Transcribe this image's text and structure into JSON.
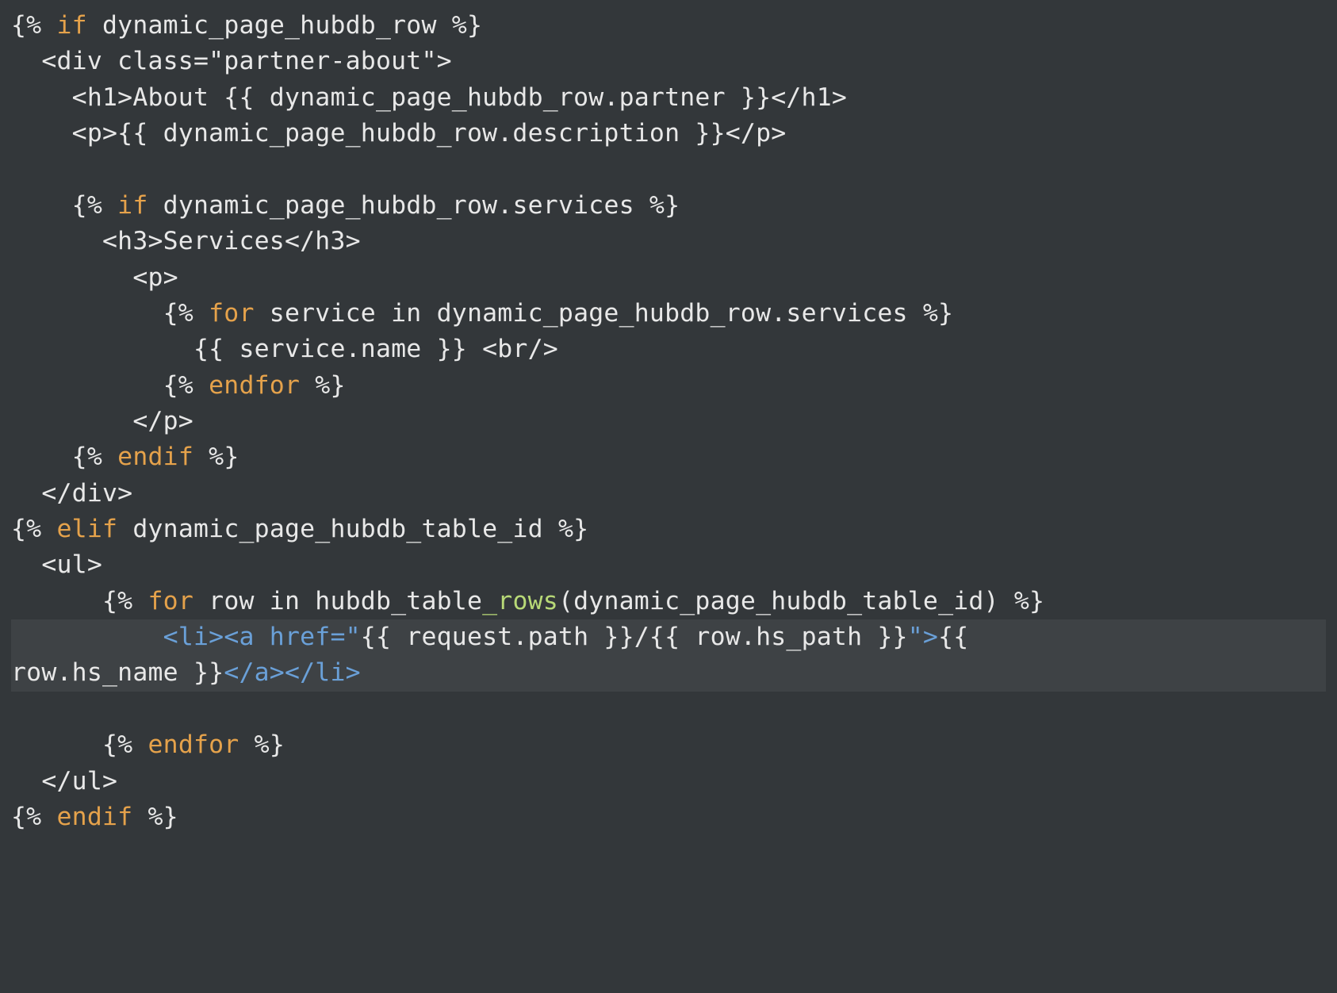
{
  "code": {
    "l1a": "{% ",
    "l1kw": "if",
    "l1b": " dynamic_page_hubdb_row %}",
    "l2": "  <div class=\"partner-about\">",
    "l3": "    <h1>About {{ dynamic_page_hubdb_row.partner }}</h1>",
    "l4": "    <p>{{ dynamic_page_hubdb_row.description }}</p>",
    "l5": "",
    "l6a": "    {% ",
    "l6kw": "if",
    "l6b": " dynamic_page_hubdb_row.services %}",
    "l7": "      <h3>Services</h3>",
    "l8": "        <p>",
    "l9a": "          {% ",
    "l9kw": "for",
    "l9b": " service in dynamic_page_hubdb_row.services %}",
    "l10": "            {{ service.name }} <br/>",
    "l11a": "          {% ",
    "l11kw": "endfor",
    "l11b": " %}",
    "l12": "        </p>",
    "l13a": "    {% ",
    "l13kw": "endif",
    "l13b": " %}",
    "l14": "  </div>",
    "l15a": "{% ",
    "l15kw": "elif",
    "l15b": " dynamic_page_hubdb_table_id %}",
    "l16": "  <ul>",
    "l17a": "      {% ",
    "l17kw": "for",
    "l17b": " row in hubdb_table",
    "l17fn": "_rows",
    "l17c": "(dynamic_page_hubdb_table_id) %}",
    "l18a": "          ",
    "l18tag1": "<li><a href=\"",
    "l18mid": "{{ request.path }}/{{ row.hs_path }}",
    "l18tag2": "\">",
    "l18end": "{{ ",
    "l19a": "row.hs_name }}",
    "l19tag": "</a></li>",
    "l20a": "      {% ",
    "l20kw": "endfor",
    "l20b": " %}",
    "l21": "  </ul>",
    "l22a": "{% ",
    "l22kw": "endif",
    "l22b": " %}"
  }
}
